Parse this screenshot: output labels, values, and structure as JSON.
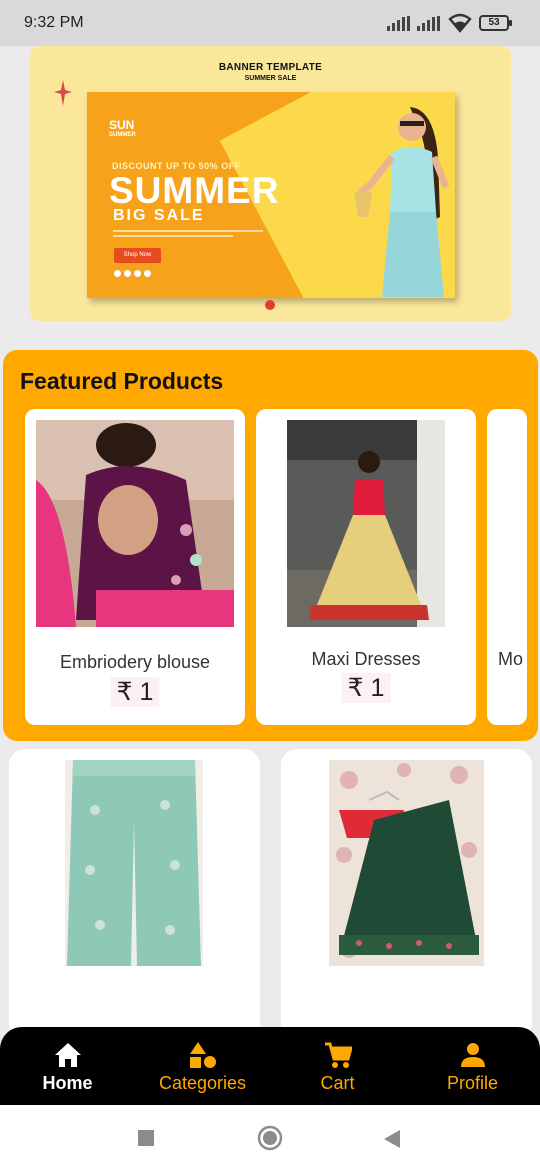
{
  "status": {
    "time": "9:32 PM",
    "battery": "53"
  },
  "banner": {
    "title": "BANNER TEMPLATE",
    "subtitle": "SUMMER SALE",
    "brand": "SUN",
    "brand_sub": "SUMMER",
    "discount": "DISCOUNT UP TO 50% OFF",
    "headline": "SUMMER",
    "subheadline": "BIG SALE",
    "button": "Shop Now",
    "active_slide": 1
  },
  "featured": {
    "title": "Featured Products",
    "items": [
      {
        "name": "Embriodery blouse",
        "price": "₹ 1"
      },
      {
        "name": "Maxi Dresses",
        "price": "₹ 1"
      },
      {
        "name": "Mo",
        "price": ""
      }
    ]
  },
  "products": [
    {
      "image": "mint-green-palazzo"
    },
    {
      "image": "green-lehenga-red-blouse"
    }
  ],
  "bottom_nav": {
    "items": [
      {
        "label": "Home",
        "icon": "home-icon",
        "active": true
      },
      {
        "label": "Categories",
        "icon": "categories-icon",
        "active": false
      },
      {
        "label": "Cart",
        "icon": "cart-icon",
        "active": false
      },
      {
        "label": "Profile",
        "icon": "profile-icon",
        "active": false
      }
    ]
  },
  "colors": {
    "accent": "#ffa800",
    "nav_bg": "#000000",
    "page_bg": "#ebebeb"
  }
}
